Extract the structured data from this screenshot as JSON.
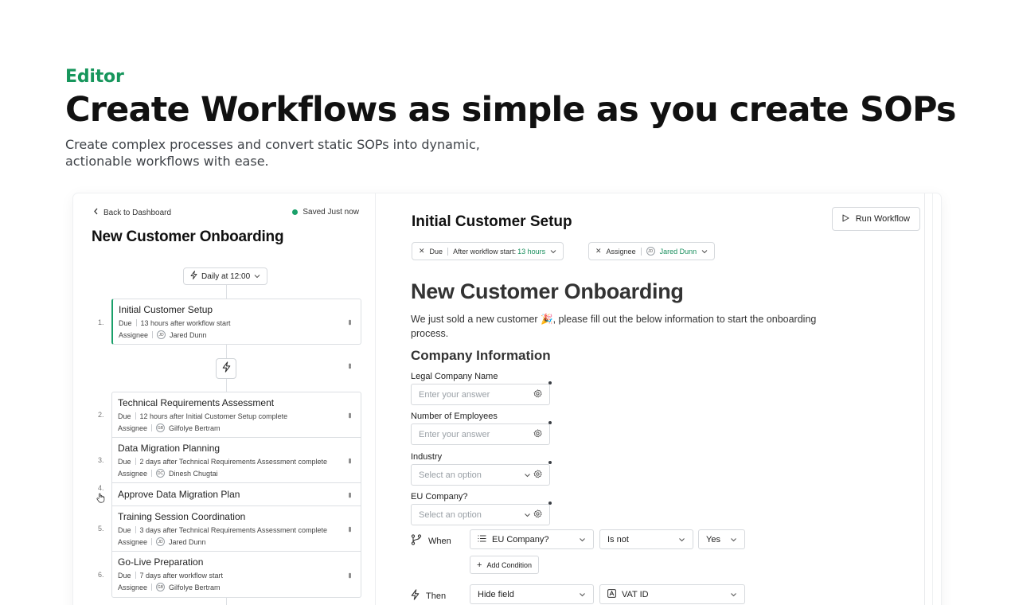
{
  "hero": {
    "eyebrow": "Editor",
    "headline": "Create Workflows as simple as you create SOPs",
    "subtitle": "Create complex processes and convert static SOPs into dynamic, actionable workflows with ease."
  },
  "colors": {
    "accent": "#17965c",
    "saved_dot": "#1aa06a"
  },
  "left": {
    "back_label": "Back to Dashboard",
    "saved_label": "Saved Just now",
    "title": "New Customer Onboarding",
    "trigger_label": "Daily at 12:00",
    "steps": [
      {
        "num": "1.",
        "title": "Initial Customer Setup",
        "due_label": "Due",
        "due": "13 hours after workflow start",
        "assignee_label": "Assignee",
        "initials": "JD",
        "assignee": "Jared Dunn"
      },
      {
        "num": "2.",
        "title": "Technical Requirements Assessment",
        "due_label": "Due",
        "due": "12 hours after Initial Customer Setup complete",
        "assignee_label": "Assignee",
        "initials": "GB",
        "assignee": "Gilfolye Bertram"
      },
      {
        "num": "3.",
        "title": "Data Migration Planning",
        "due_label": "Due",
        "due": "2 days after Technical Requirements Assessment complete",
        "assignee_label": "Assignee",
        "initials": "DC",
        "assignee": "Dinesh Chugtai"
      },
      {
        "num": "4.",
        "title": "Approve Data Migration Plan"
      },
      {
        "num": "5.",
        "title": "Training Session Coordination",
        "due_label": "Due",
        "due": "3 days after Technical Requirements Assessment complete",
        "assignee_label": "Assignee",
        "initials": "JD",
        "assignee": "Jared Dunn"
      },
      {
        "num": "6.",
        "title": "Go-Live Preparation",
        "due_label": "Due",
        "due": "7 days after workflow start",
        "assignee_label": "Assignee",
        "initials": "GB",
        "assignee": "Gilfolye Bertram"
      }
    ]
  },
  "right": {
    "title": "Initial Customer Setup",
    "run_label": "Run Workflow",
    "chips": {
      "due_label": "Due",
      "due_prefix": "After workflow start:",
      "due_value": "13 hours",
      "assignee_label": "Assignee",
      "assignee_initials": "JD",
      "assignee_value": "Jared Dunn"
    },
    "doc_title": "New Customer Onboarding",
    "doc_intro": "We just sold a new customer 🎉, please fill out the below information to start the onboarding process.",
    "section_title": "Company Information",
    "fields": [
      {
        "label": "Legal Company Name",
        "placeholder": "Enter your answer"
      },
      {
        "label": "Number of Employees",
        "placeholder": "Enter your answer"
      },
      {
        "label": "Industry",
        "placeholder": "Select an option"
      },
      {
        "label": "EU Company?",
        "placeholder": "Select an option"
      }
    ],
    "rule": {
      "when_label": "When",
      "field": "EU Company?",
      "operator": "Is not",
      "value": "Yes",
      "add_condition": "Add Condition",
      "then_label": "Then",
      "action": "Hide field",
      "target": "VAT ID"
    }
  }
}
